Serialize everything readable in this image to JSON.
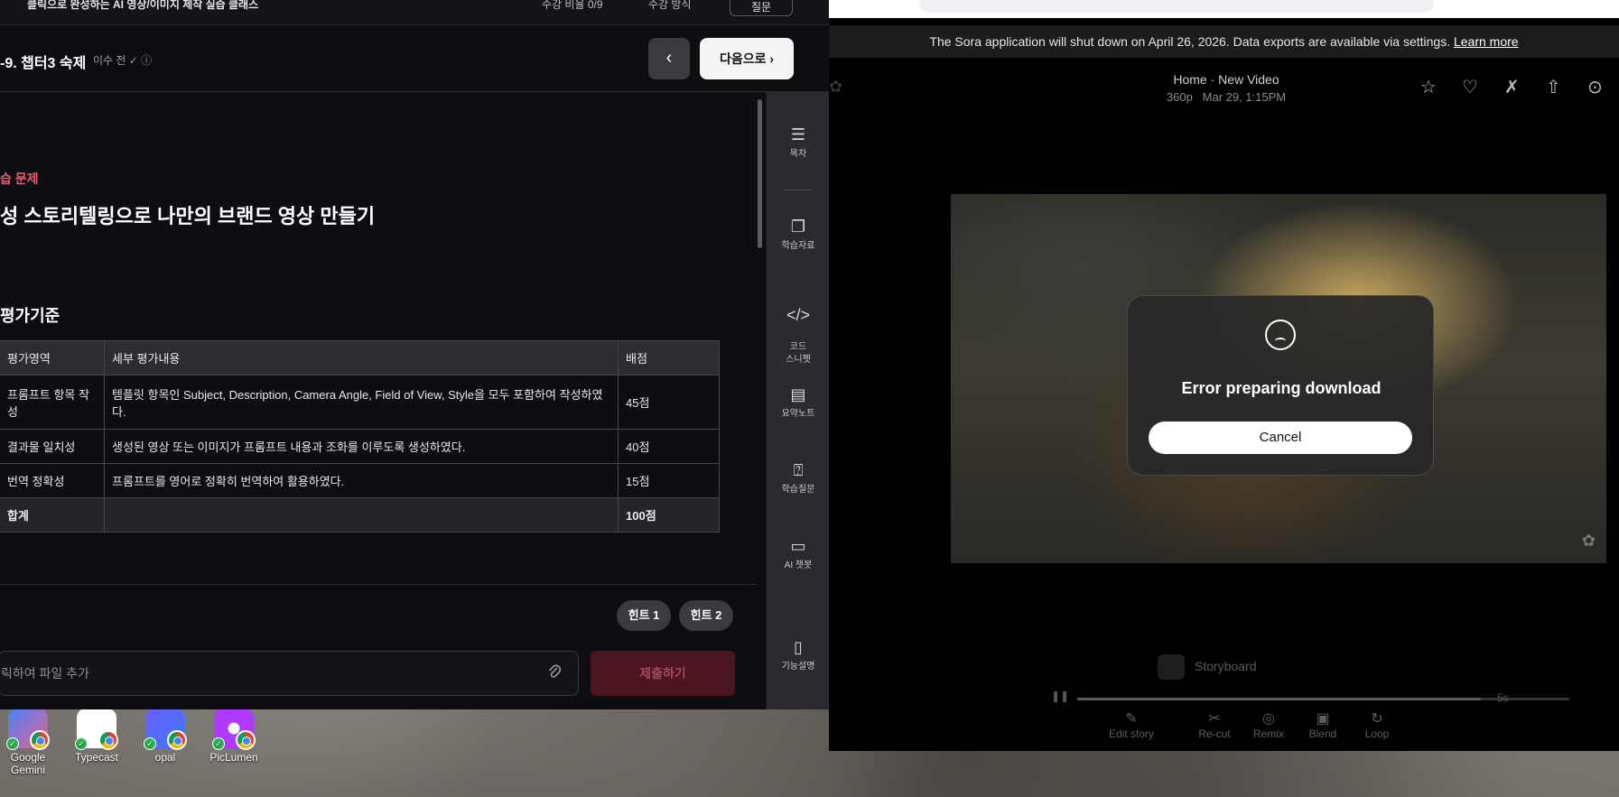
{
  "lms": {
    "top": {
      "course_title": "클릭으로 완성하는 AI 영상/이미지 제작 실습 클래스",
      "meta1": "수강 비율 0/9",
      "meta2": "수강 방식",
      "question_btn": "질문"
    },
    "chapter": "-9. 챕터3 숙제",
    "status": "이수 전 ✓ ⓘ",
    "prev": "‹",
    "next": "다음으로 ›",
    "sub_label": "습 문제",
    "problem_title": "성 스토리텔링으로 나만의 브랜드 영상 만들기",
    "criteria_heading": "평가기준",
    "table": {
      "headers": [
        "평가영역",
        "세부 평가내용",
        "배점"
      ],
      "rows": [
        [
          "프롬프트 항목 작성",
          "템플릿 항목인 Subject, Description, Camera Angle, Field of View, Style을 모두 포함하여 작성하였다.",
          "45점"
        ],
        [
          "결과물 일치성",
          "생성된 영상 또는 이미지가 프롬프트 내용과 조화를 이루도록 생성하였다.",
          "40점"
        ],
        [
          "번역 정확성",
          "프롬프트를 영어로 정확히 번역하여 활용하였다.",
          "15점"
        ]
      ],
      "total": [
        "합계",
        "",
        "100점"
      ]
    },
    "hint1": "힌트 1",
    "hint2": "힌트 2",
    "file_placeholder": "릭하여 파일 추가",
    "submit": "제출하기",
    "rail": [
      {
        "icon": "list-icon",
        "label": "목차"
      },
      {
        "icon": "copy-icon",
        "label": "학습자료"
      },
      {
        "icon": "code-icon",
        "label": "코드\n스니펫"
      },
      {
        "icon": "note-icon",
        "label": "요약노트"
      },
      {
        "icon": "question-icon",
        "label": "학습질문"
      },
      {
        "icon": "chat-icon",
        "label": "AI 챗봇"
      },
      {
        "icon": "book-icon",
        "label": "기능설명"
      }
    ]
  },
  "sora": {
    "notice": "The Sora application will shut down on April 26, 2026. Data exports are available via settings.",
    "notice_link": "Learn more",
    "crumb_home": "Home",
    "crumb_sep": "·",
    "crumb_page": "New Video",
    "sub": "360p   Mar 29, 1:15PM",
    "dialog_title": "Error preparing download",
    "dialog_cancel": "Cancel",
    "storyboard": "Storyboard",
    "duration": "5s",
    "tools": [
      "Edit story",
      "Re-cut",
      "Remix",
      "Blend",
      "Loop"
    ]
  },
  "desktop": {
    "icons": [
      "Google\nGemini",
      "Typecast",
      "opal",
      "PicLumen"
    ]
  }
}
